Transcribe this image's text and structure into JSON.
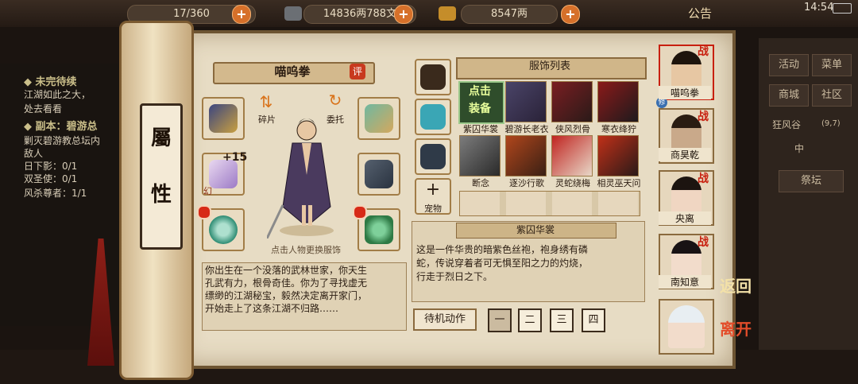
{
  "top_bar": {
    "capacity": "17/360",
    "silver": "14836两788文",
    "gold": "8547两",
    "notice": "公告",
    "time": "14:54"
  },
  "quest_panel": {
    "header1": "◆ 未完待续",
    "line1": "江湖如此之大，",
    "line2": "处去看看",
    "header2": "◆ 副本：碧游总",
    "line3": "剿灭碧游教总坛内",
    "line4": "敌人",
    "line5": "日下影：0/1",
    "line6": "双圣使：0/1",
    "line7": "风杀尊者：1/1"
  },
  "scroll_tab": {
    "char1": "屬",
    "char2": "性"
  },
  "character": {
    "name": "喵呜拳",
    "rate_label": "评",
    "shard_label": "碎片",
    "entrust_label": "委托",
    "upgrade_level": "+15",
    "phantom_mark": "幻",
    "change_hint": "点击人物更换服饰",
    "bio": "你出生在一个没落的武林世家，你天生\n孔武有力，根骨奇佳。你为了寻找虚无\n缥缈的江湖秘宝，毅然决定离开家门，\n开始走上了这条江湖不归路……"
  },
  "equipment_icons": [
    "armor-icon",
    "mask-icon",
    "scroll-weapon-icon",
    "chest-armor-icon",
    "ring-icon",
    "jade-pendant-icon"
  ],
  "category": {
    "add_label": "宠物",
    "add_symbol": "+"
  },
  "clothing": {
    "title": "服饰列表",
    "equip_button": "点击\n装备",
    "items": [
      "紫囚华裳",
      "碧游长老衣",
      "侠风烈骨",
      "寒衣绛狞",
      "断念",
      "逐沙行歌",
      "灵蛇绕梅",
      "相灵巫天问"
    ],
    "selected_title": "紫囚华裳",
    "description": "这是一件华贵的暗紫色丝袍，袍身绣有磷\n蛇，传说穿着者可无惧至阳之力的灼烧，\n行走于烈日之下。"
  },
  "actions": {
    "idle_label": "待机动作",
    "buttons": [
      "一",
      "二",
      "三",
      "四"
    ]
  },
  "party": {
    "members": [
      {
        "name": "喵呜拳",
        "war": "战",
        "tag": "修"
      },
      {
        "name": "商昊乾",
        "war": "战"
      },
      {
        "name": "央离",
        "war": "战"
      },
      {
        "name": "南知意",
        "war": "战"
      },
      {
        "name": ""
      }
    ]
  },
  "right_menu": {
    "activity": "活动",
    "menu": "菜单",
    "shop": "商城",
    "community": "社区",
    "region": "狂风谷",
    "coords": "(9,7)",
    "compass": "中",
    "altar": "祭坛"
  },
  "nav": {
    "return": "返回",
    "leave": "离开"
  },
  "colors": {
    "accent_red": "#c8200f",
    "paper": "#e7dcc4",
    "equip_green": "#2f4d2b"
  }
}
